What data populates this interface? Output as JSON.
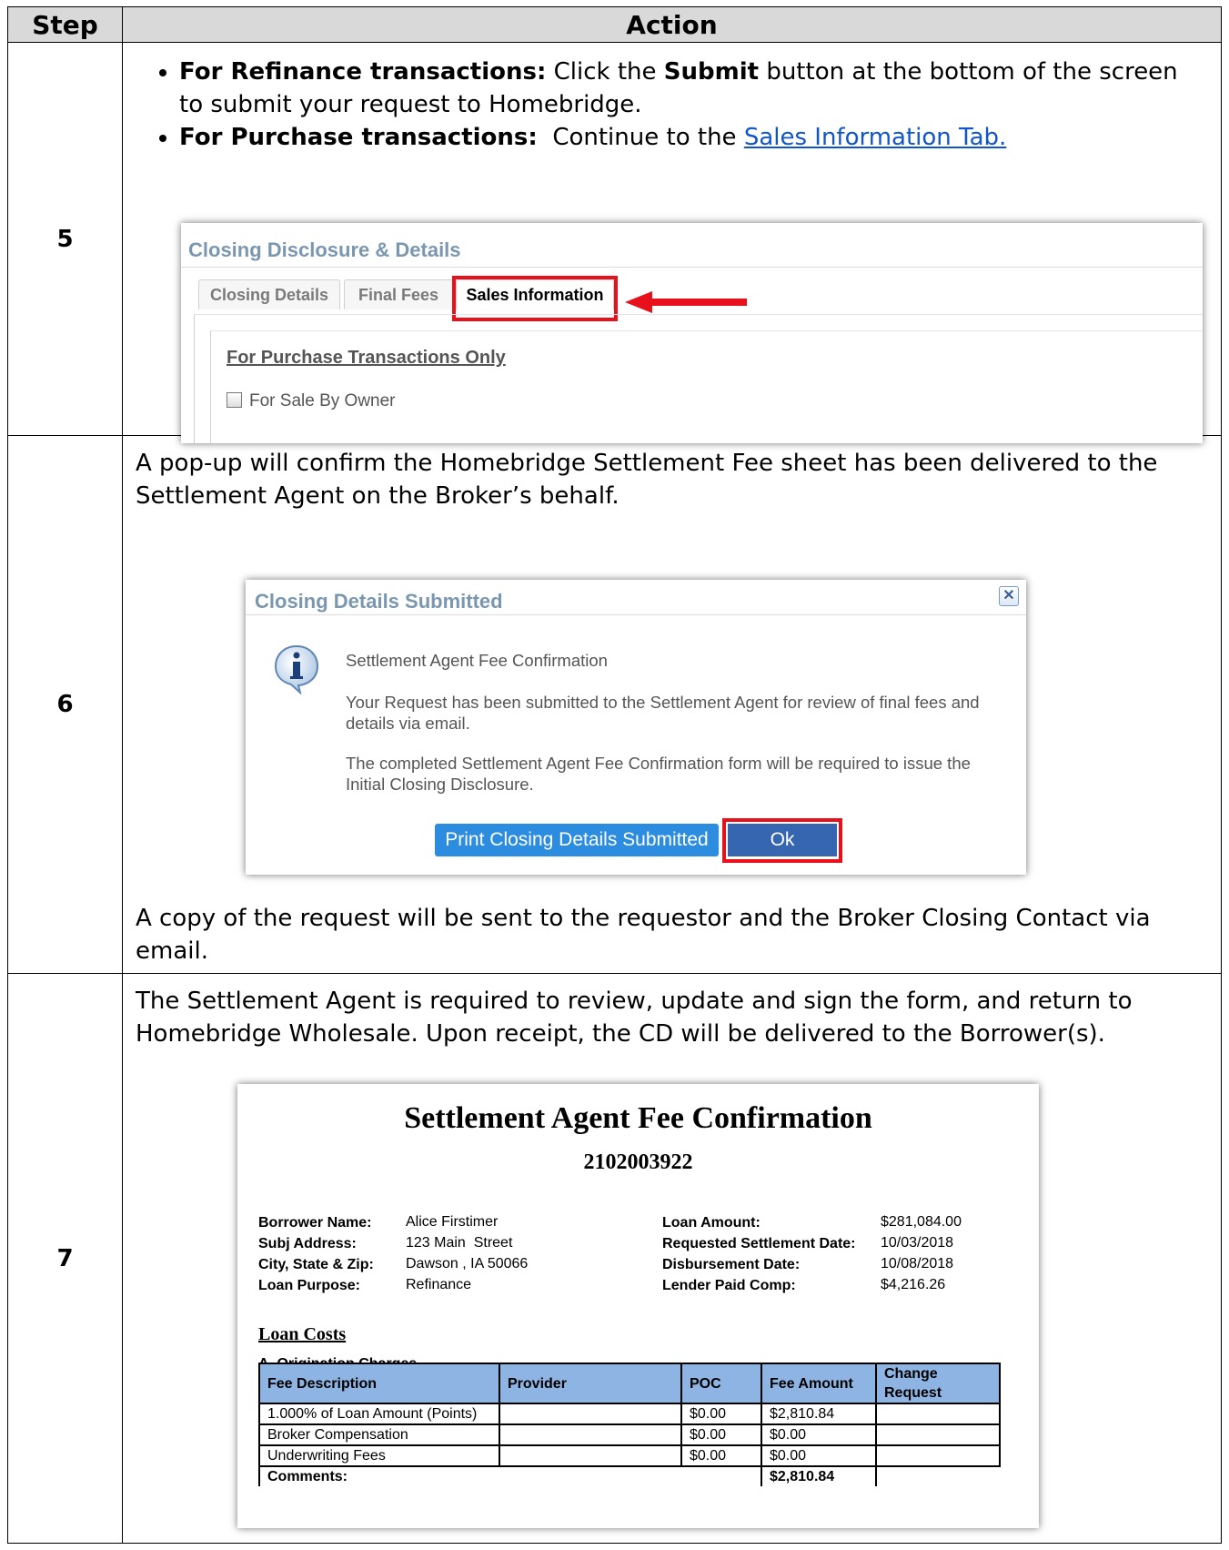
{
  "header": {
    "step": "Step",
    "action": "Action"
  },
  "step5": {
    "number": "5",
    "bullet1_bold": "For Refinance transactions:",
    "bullet1_pre": " Click the ",
    "bullet1_bold2": "Submit",
    "bullet1_post": " button at the bottom of the screen to submit your request to Homebridge.",
    "bullet2_bold": "For Purchase transactions:",
    "bullet2_pre": "  Continue to the ",
    "bullet2_link": "Sales Information Tab.",
    "shot": {
      "title": "Closing Disclosure & Details",
      "tabs": [
        "Closing Details",
        "Final Fees",
        "Sales Information"
      ],
      "section_title": "For Purchase Transactions Only",
      "checkbox_label": "For Sale By Owner"
    }
  },
  "step6": {
    "number": "6",
    "intro": "A pop-up will confirm the Homebridge Settlement Fee sheet has been delivered to the Settlement Agent on the Broker’s behalf.",
    "outro": "A copy of the request will be sent to the requestor and the Broker Closing Contact via email.",
    "dialog": {
      "title": "Closing Details Submitted",
      "close": "✕",
      "heading": "Settlement Agent Fee Confirmation",
      "para1": "Your Request has been submitted to the Settlement Agent for review of final fees and details via email.",
      "para2": "The completed Settlement Agent Fee Confirmation form will be required to issue the Initial Closing Disclosure.",
      "print_button": "Print Closing Details Submitted",
      "ok_button": "Ok",
      "icon": "info-icon"
    }
  },
  "step7": {
    "number": "7",
    "intro": "The Settlement Agent is required to review, update and sign the form, and return to Homebridge Wholesale. Upon receipt, the CD will be delivered to the Borrower(s).",
    "form": {
      "title": "Settlement Agent Fee Confirmation",
      "number": "2102003922",
      "left_labels": [
        "Borrower Name:",
        "Subj Address:",
        "City, State & Zip:",
        "Loan Purpose:"
      ],
      "left_values": [
        "Alice Firstimer",
        "123 Main  Street",
        "Dawson , IA 50066",
        "Refinance"
      ],
      "right_labels": [
        "Loan Amount:",
        "Requested Settlement Date:",
        "Disbursement Date:",
        "Lender Paid Comp:"
      ],
      "right_values": [
        "$281,084.00",
        "10/03/2018",
        "10/08/2018",
        "$4,216.26"
      ],
      "loan_costs": "Loan Costs",
      "section": "A. Origination Charges",
      "columns": [
        "Fee Description",
        "Provider",
        "POC",
        "Fee Amount",
        "Change Request"
      ],
      "rows": [
        [
          "1.000% of Loan Amount (Points)",
          "",
          "$0.00",
          "$2,810.84",
          ""
        ],
        [
          "Broker Compensation",
          "",
          "$0.00",
          "$0.00",
          ""
        ],
        [
          "Underwriting Fees",
          "",
          "$0.00",
          "$0.00",
          ""
        ]
      ],
      "comments_label": "Comments:",
      "total": "$2,810.84"
    }
  },
  "colors": {
    "highlight": "#e8101a",
    "link": "#1155cc",
    "header_bg": "#d9d9d9",
    "table_header": "#8db4e2"
  }
}
